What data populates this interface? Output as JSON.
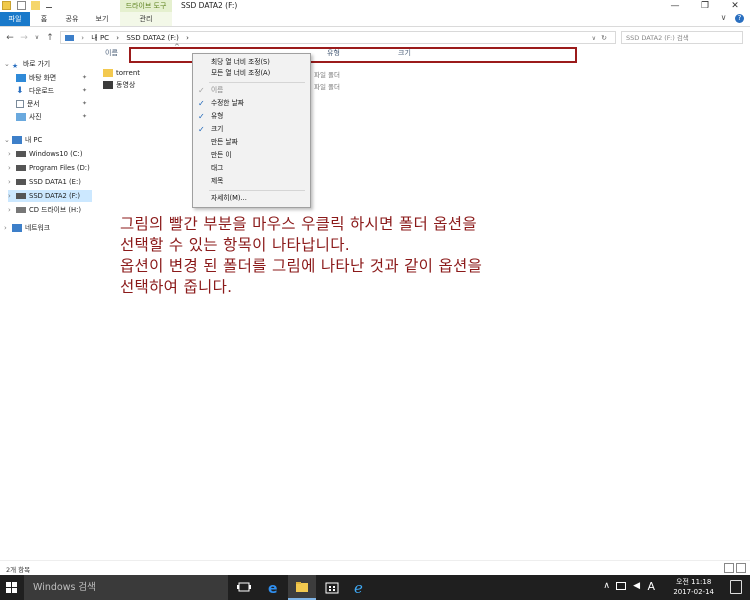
{
  "window": {
    "title": "SSD DATA2 (F:)",
    "context_tab_title": "드라이브 도구",
    "min_glyph": "—",
    "max_glyph": "❐",
    "close_glyph": "✕"
  },
  "ribbon": {
    "tabs": [
      "파일",
      "홈",
      "공유",
      "보기",
      "관리"
    ],
    "expand_glyph": "∨",
    "help_glyph": "?"
  },
  "address": {
    "back_glyph": "←",
    "forward_glyph": "→",
    "recent_glyph": "∨",
    "up_glyph": "↑",
    "path": [
      "내 PC",
      "›",
      "SSD DATA2 (F:)",
      "›"
    ],
    "dropdown_glyph": "∨",
    "refresh_glyph": "↻",
    "search_placeholder": "SSD DATA2 (F:) 검색"
  },
  "nav": {
    "quick_access": "바로 가기",
    "quick_items": [
      "바탕 화면",
      "다운로드",
      "문서",
      "사진"
    ],
    "this_pc": "내 PC",
    "drives": [
      "Windows10 (C:)",
      "Program Files (D:)",
      "SSD DATA1 (E:)",
      "SSD DATA2 (F:)",
      "CD 드라이브 (H:)"
    ],
    "network": "네트워크"
  },
  "columns": {
    "name": "이름",
    "type": "유형",
    "size": "크기"
  },
  "files": [
    {
      "name": "torrent",
      "type": "파일 폴더"
    },
    {
      "name": "동영상",
      "type": "파일 폴더"
    }
  ],
  "context_menu": {
    "items": [
      {
        "label": "최당 열 너비 조정(S)",
        "checked": false,
        "disabled": false
      },
      {
        "label": "모든 열 너비 조정(A)",
        "checked": false,
        "disabled": false
      },
      {
        "label": "이름",
        "checked": true,
        "disabled": true
      },
      {
        "label": "수정한 날짜",
        "checked": true,
        "disabled": false
      },
      {
        "label": "유형",
        "checked": true,
        "disabled": false
      },
      {
        "label": "크기",
        "checked": true,
        "disabled": false
      },
      {
        "label": "만든 날짜",
        "checked": false,
        "disabled": false
      },
      {
        "label": "만든 이",
        "checked": false,
        "disabled": false
      },
      {
        "label": "태그",
        "checked": false,
        "disabled": false
      },
      {
        "label": "제목",
        "checked": false,
        "disabled": false
      },
      {
        "label": "자세히(M)...",
        "checked": false,
        "disabled": false
      }
    ]
  },
  "annotation": {
    "lines": [
      "그림의 빨간 부분을 마우스 우클릭 하시면 폴더 옵션을",
      "선택할 수 있는 항목이 나타납니다.",
      "옵션이 변경 된 폴더를 그림에 나타난 것과 같이 옵션을",
      "선택하여 줍니다."
    ],
    "color": "#8b1a1a"
  },
  "status": {
    "item_count": "2개 항목"
  },
  "taskbar": {
    "search_placeholder": "Windows 검색",
    "ime_indicator": "A",
    "time": "오전 11:18",
    "date": "2017-02-14",
    "tray_glyph": "∧"
  }
}
